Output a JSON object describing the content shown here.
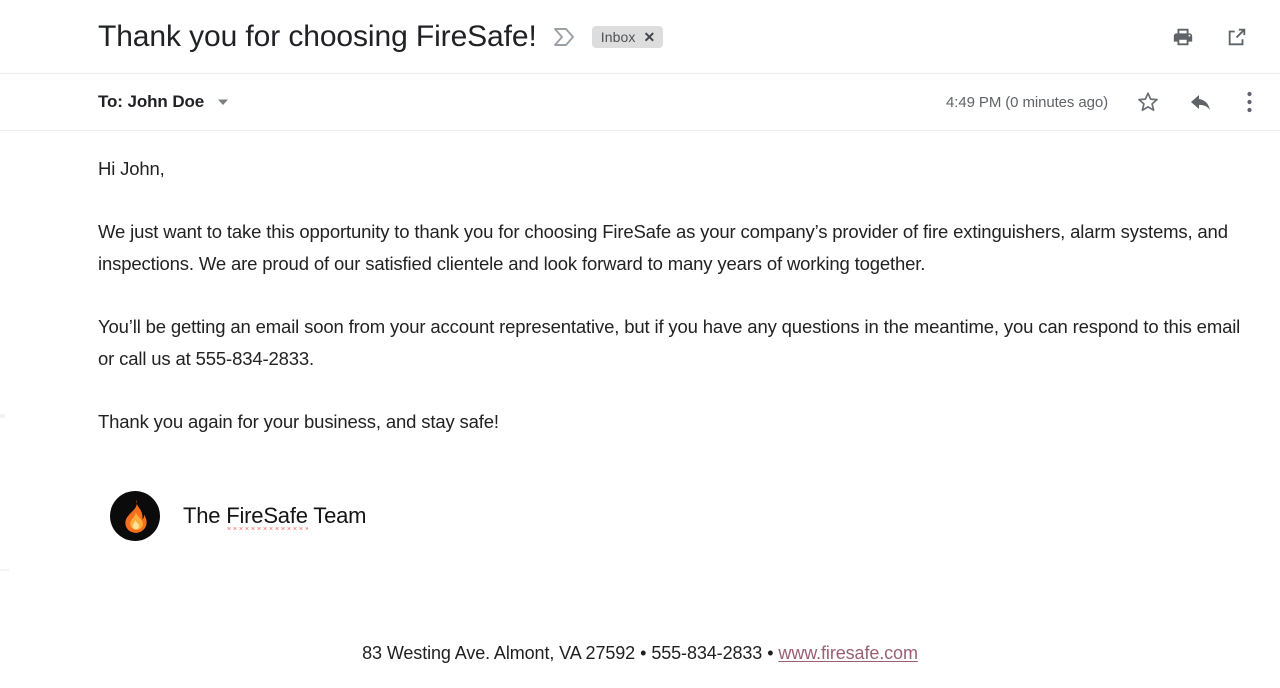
{
  "header": {
    "subject": "Thank you for choosing FireSafe!",
    "important_marker_icon": "label-marker-icon",
    "inbox_chip": {
      "label": "Inbox",
      "close_glyph": "✕"
    },
    "actions": [
      {
        "name": "print-icon",
        "title": "Print all"
      },
      {
        "name": "open-in-new-window-icon",
        "title": "Open in new window"
      }
    ]
  },
  "recipient": {
    "to_line": "To: John Doe",
    "details_caret_icon": "chevron-down-icon",
    "timestamp": "4:49 PM (0 minutes ago)",
    "actions": [
      {
        "name": "star-icon",
        "title": "Not starred"
      },
      {
        "name": "reply-icon",
        "title": "Reply"
      },
      {
        "name": "more-options-icon",
        "title": "More"
      }
    ]
  },
  "body": {
    "greeting": "Hi John,",
    "paragraph_1": "We just want to take this opportunity to thank you for choosing FireSafe as your company’s provider of fire extinguishers, alarm systems, and inspections. We are proud of our satisfied clientele and look forward to many years of working together.",
    "paragraph_2": "You’ll be getting an email soon from your account representative, but if you have any questions in the meantime, you can respond to this email or call us at 555-834-2833.",
    "closing": "Thank you again for your business, and stay safe!"
  },
  "signature": {
    "logo_icon": "flame-logo-icon",
    "name_prefix": "The ",
    "name_brand": "FireSafe",
    "name_suffix": " Team"
  },
  "footer": {
    "address": "83 Westing Ave. Almont, VA 27592",
    "separator": "•",
    "phone": "555-834-2833",
    "website": "www.firesafe.com"
  },
  "colors": {
    "text": "#202124",
    "muted_text": "#5f6368",
    "chip_background": "#ddddde",
    "link": "#9a5f74",
    "logo_background": "#0b0b0b",
    "flame_outer": "#f4701f",
    "flame_inner": "#fbb03b",
    "spellcheck_underline": "#e8342a"
  }
}
